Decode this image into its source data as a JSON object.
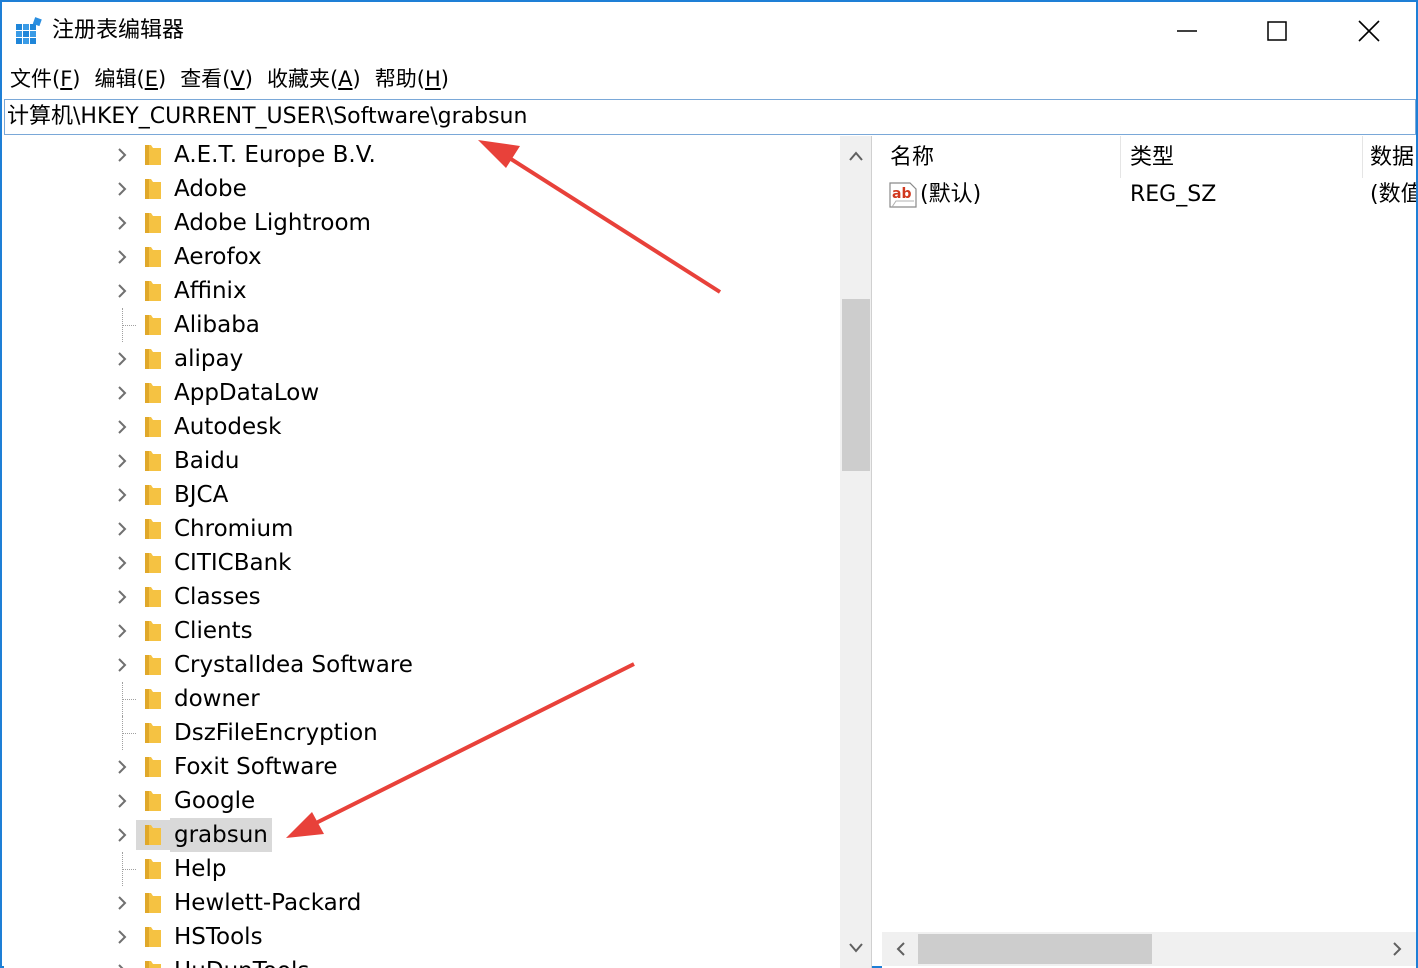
{
  "window": {
    "title": "注册表编辑器",
    "accent": "#1e7fd6"
  },
  "titlebar_buttons": {
    "minimize_icon": "minimize-icon",
    "maximize_icon": "maximize-icon",
    "close_icon": "close-icon"
  },
  "menu": [
    {
      "label": "文件(",
      "key": "F",
      "suffix": ")"
    },
    {
      "label": "编辑(",
      "key": "E",
      "suffix": ")"
    },
    {
      "label": "查看(",
      "key": "V",
      "suffix": ")"
    },
    {
      "label": "收藏夹(",
      "key": "A",
      "suffix": ")"
    },
    {
      "label": "帮助(",
      "key": "H",
      "suffix": ")"
    }
  ],
  "address": {
    "path": "计算机\\HKEY_CURRENT_USER\\Software\\grabsun"
  },
  "tree": {
    "items": [
      {
        "label": "A.E.T. Europe B.V.",
        "expandable": true,
        "selected": false
      },
      {
        "label": "Adobe",
        "expandable": true,
        "selected": false
      },
      {
        "label": "Adobe Lightroom",
        "expandable": true,
        "selected": false
      },
      {
        "label": "Aerofox",
        "expandable": true,
        "selected": false
      },
      {
        "label": "Affinix",
        "expandable": true,
        "selected": false
      },
      {
        "label": "Alibaba",
        "expandable": false,
        "selected": false
      },
      {
        "label": "alipay",
        "expandable": true,
        "selected": false
      },
      {
        "label": "AppDataLow",
        "expandable": true,
        "selected": false
      },
      {
        "label": "Autodesk",
        "expandable": true,
        "selected": false
      },
      {
        "label": "Baidu",
        "expandable": true,
        "selected": false
      },
      {
        "label": "BJCA",
        "expandable": true,
        "selected": false
      },
      {
        "label": "Chromium",
        "expandable": true,
        "selected": false
      },
      {
        "label": "CITICBank",
        "expandable": true,
        "selected": false
      },
      {
        "label": "Classes",
        "expandable": true,
        "selected": false
      },
      {
        "label": "Clients",
        "expandable": true,
        "selected": false
      },
      {
        "label": "CrystalIdea Software",
        "expandable": true,
        "selected": false
      },
      {
        "label": "downer",
        "expandable": false,
        "selected": false
      },
      {
        "label": "DszFileEncryption",
        "expandable": false,
        "selected": false
      },
      {
        "label": "Foxit Software",
        "expandable": true,
        "selected": false
      },
      {
        "label": "Google",
        "expandable": true,
        "selected": false
      },
      {
        "label": "grabsun",
        "expandable": true,
        "selected": true
      },
      {
        "label": "Help",
        "expandable": false,
        "selected": false
      },
      {
        "label": "Hewlett-Packard",
        "expandable": true,
        "selected": false
      },
      {
        "label": "HSTools",
        "expandable": true,
        "selected": false
      },
      {
        "label": "HuDunTools",
        "expandable": true,
        "selected": false
      }
    ],
    "scroll_position": 0.2
  },
  "values": {
    "columns": [
      "名称",
      "类型",
      "数据"
    ],
    "rows": [
      {
        "name": "(默认)",
        "type": "REG_SZ",
        "data": "(数值未设置)"
      }
    ]
  },
  "colors": {
    "arrow": "#e8413a",
    "selection": "#d9d9d9",
    "folder": "#f5c242",
    "ab_icon_text": "#d1391f"
  }
}
